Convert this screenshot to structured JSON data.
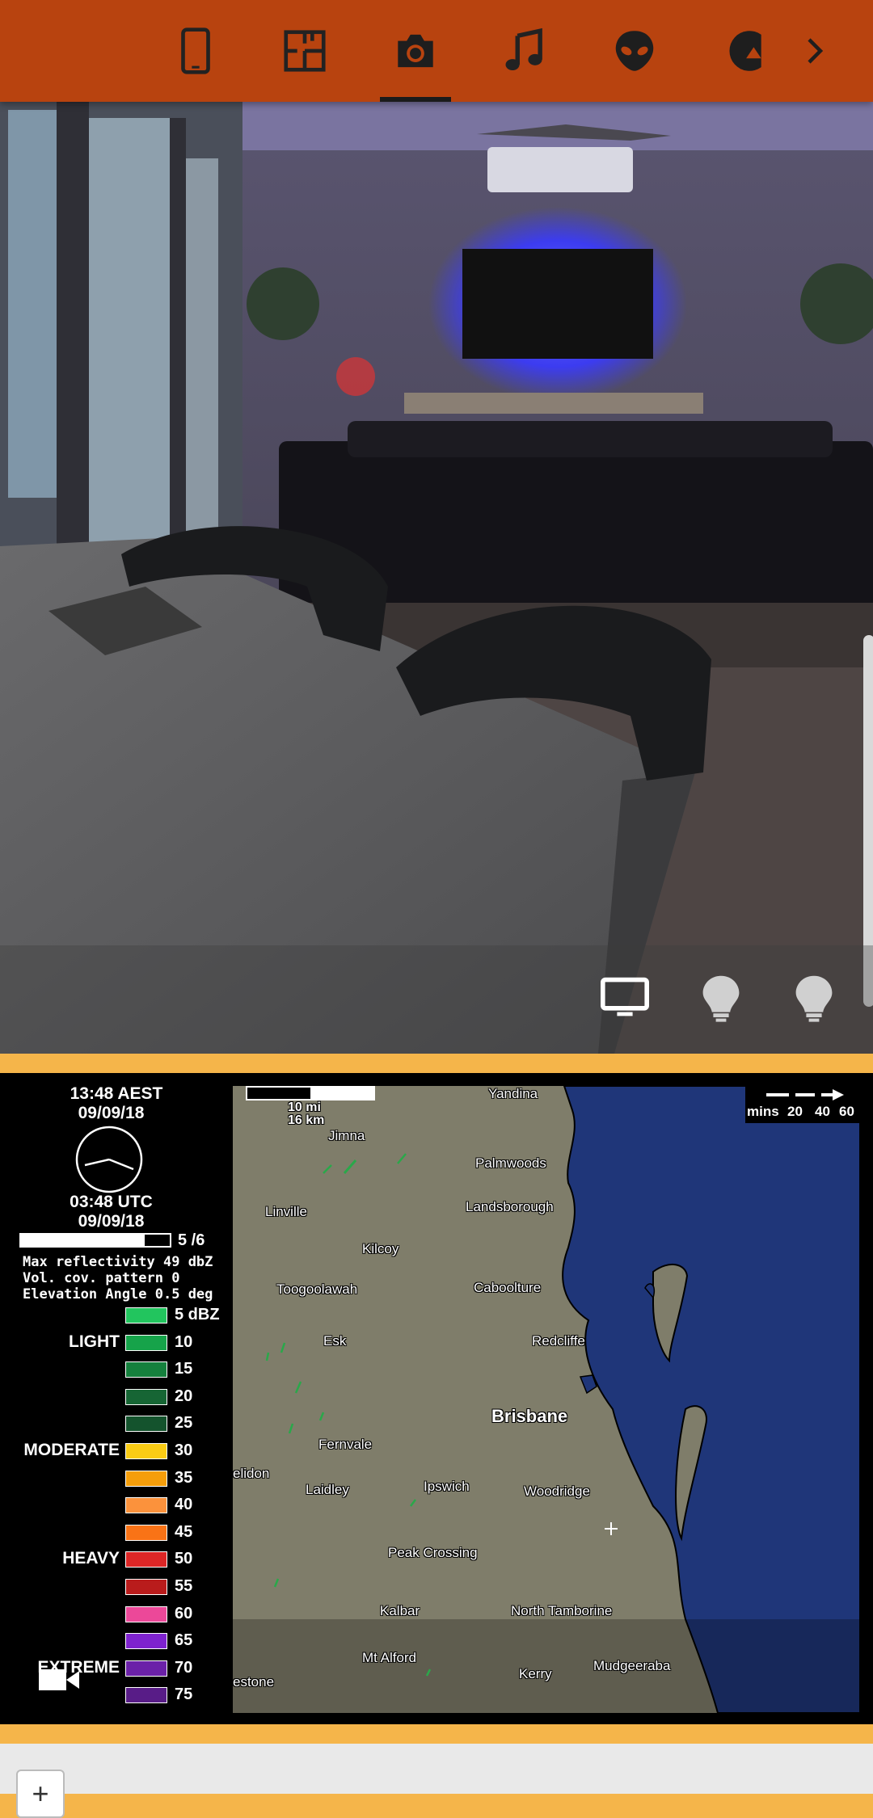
{
  "colors": {
    "topbar": "#b8430f",
    "accent": "#f5b54a",
    "map_land": "#7f7d6a",
    "map_sea": "#1f3679"
  },
  "nav": {
    "tabs": [
      {
        "icon": "tablet-icon",
        "active": false
      },
      {
        "icon": "floorplan-icon",
        "active": false
      },
      {
        "icon": "camera-icon",
        "active": true
      },
      {
        "icon": "music-icon",
        "active": false
      },
      {
        "icon": "alien-icon",
        "active": false
      },
      {
        "icon": "partial-circle-icon",
        "active": false
      }
    ],
    "more_icon": "chevron-right-icon"
  },
  "camera": {
    "controls": [
      "tv-icon",
      "lightbulb-icon",
      "lightbulb-icon"
    ]
  },
  "radar": {
    "local_time": "13:48 AEST",
    "local_date": "09/09/18",
    "utc_time": "03:48 UTC",
    "utc_date": "09/09/18",
    "frame": "5 /6",
    "frame_progress": 0.83,
    "max_reflectivity": "Max reflectivity 49 dbZ",
    "vol_cov": "Vol. cov. pattern 0",
    "elevation": "Elevation Angle 0.5 deg",
    "scale_bar_mi": "10 mi",
    "scale_bar_km": "16 km",
    "wind_arrow_label": "mins",
    "wind_ticks": [
      "20",
      "40",
      "60"
    ],
    "levels": [
      {
        "dbz": "5 dBZ",
        "color": "#22c55e",
        "band": ""
      },
      {
        "dbz": "10",
        "color": "#16a34a",
        "band": "LIGHT"
      },
      {
        "dbz": "15",
        "color": "#15803d",
        "band": ""
      },
      {
        "dbz": "20",
        "color": "#166534",
        "band": ""
      },
      {
        "dbz": "25",
        "color": "#14532d",
        "band": ""
      },
      {
        "dbz": "30",
        "color": "#facc15",
        "band": "MODERATE"
      },
      {
        "dbz": "35",
        "color": "#f59e0b",
        "band": ""
      },
      {
        "dbz": "40",
        "color": "#fb923c",
        "band": ""
      },
      {
        "dbz": "45",
        "color": "#f97316",
        "band": ""
      },
      {
        "dbz": "50",
        "color": "#dc2626",
        "band": "HEAVY"
      },
      {
        "dbz": "55",
        "color": "#b91c1c",
        "band": ""
      },
      {
        "dbz": "60",
        "color": "#ec4899",
        "band": ""
      },
      {
        "dbz": "65",
        "color": "#7e22ce",
        "band": ""
      },
      {
        "dbz": "70",
        "color": "#6b21a8",
        "band": "EXTREME"
      },
      {
        "dbz": "75",
        "color": "#581c87",
        "band": ""
      }
    ],
    "places": [
      "Yandina",
      "Jimna",
      "Palmwoods",
      "Landsborough",
      "Linville",
      "Kilcoy",
      "Toogoolawah",
      "Caboolture",
      "Esk",
      "Redcliffe",
      "Brisbane",
      "Fernvale",
      "Laidley",
      "Ipswich",
      "Woodridge",
      "Peak Crossing",
      "Kalbar",
      "North Tamborine",
      "Mt Alford",
      "Kerry",
      "Mudgeeraba",
      "elidon",
      "estone"
    ]
  },
  "bottom": {
    "zoom_in": "+"
  }
}
